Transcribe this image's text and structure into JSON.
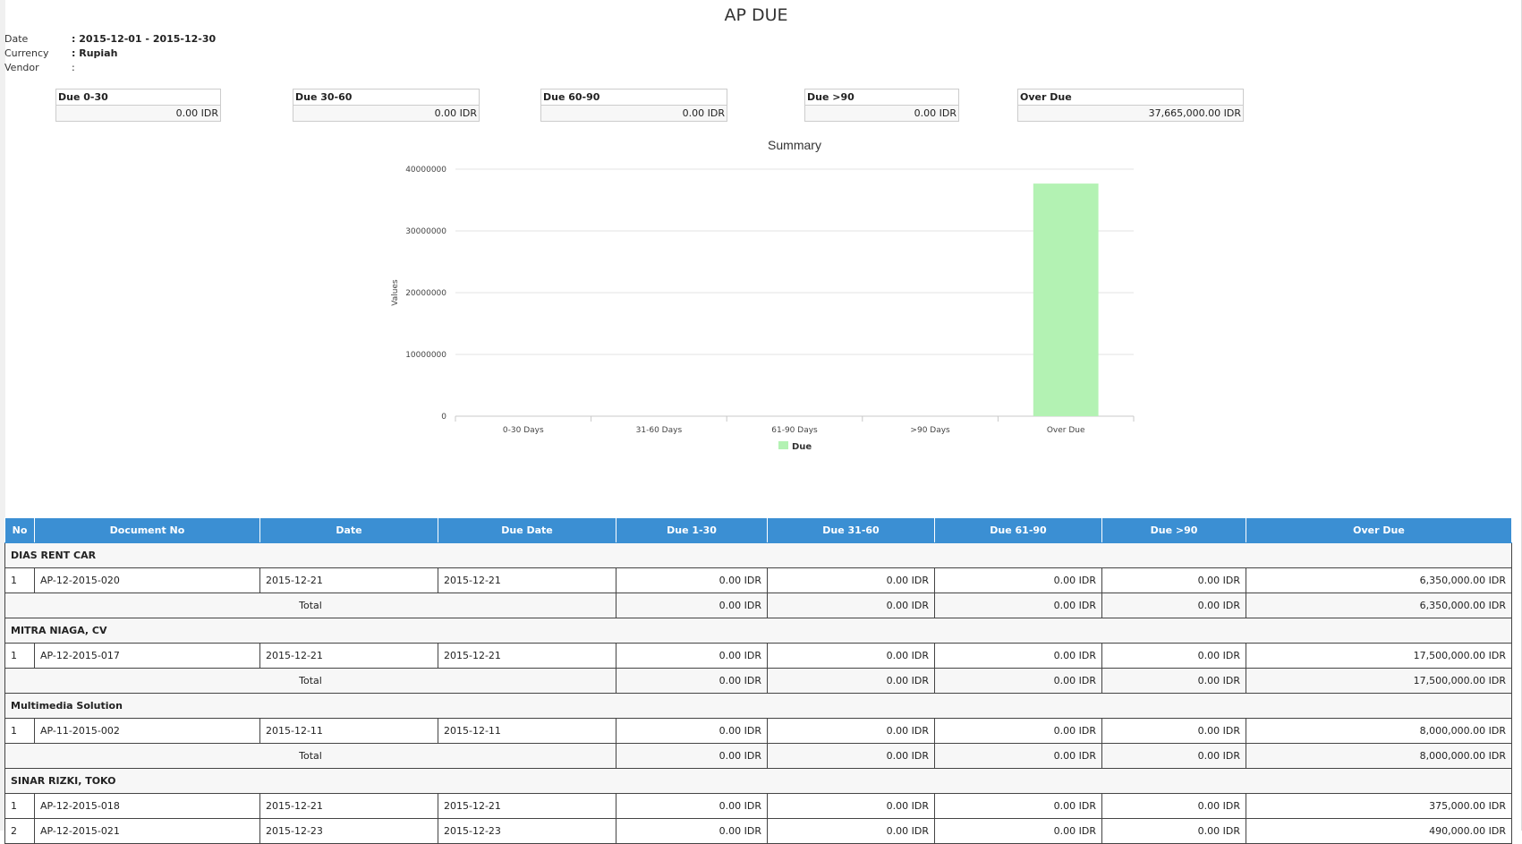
{
  "report": {
    "title": "AP DUE",
    "date_label": "Date",
    "date_value": ": 2015-12-01 - 2015-12-30",
    "currency_label": "Currency",
    "currency_value": ": Rupiah",
    "vendor_label": "Vendor",
    "vendor_value": ":"
  },
  "summary_boxes": [
    {
      "label": "Due 0-30",
      "value": "0.00 IDR"
    },
    {
      "label": "Due 30-60",
      "value": "0.00 IDR"
    },
    {
      "label": "Due 60-90",
      "value": "0.00 IDR"
    },
    {
      "label": "Due >90",
      "value": "0.00 IDR"
    },
    {
      "label": "Over Due",
      "value": "37,665,000.00 IDR"
    }
  ],
  "chart_data": {
    "type": "bar",
    "title": "Summary",
    "ylabel": "Values",
    "xlabel": "",
    "categories": [
      "0-30 Days",
      "31-60 Days",
      "61-90 Days",
      ">90 Days",
      "Over Due"
    ],
    "series": [
      {
        "name": "Due",
        "values": [
          0,
          0,
          0,
          0,
          37665000
        ]
      }
    ],
    "ylim": [
      0,
      40000000
    ],
    "yticks": [
      "0",
      "10000000",
      "20000000",
      "30000000",
      "40000000"
    ],
    "grid": true,
    "legend": "bottom-center",
    "bar_color": "#b3f2b3"
  },
  "table": {
    "headers": [
      "No",
      "Document No",
      "Date",
      "Due Date",
      "Due 1-30",
      "Due 31-60",
      "Due 61-90",
      "Due >90",
      "Over Due"
    ],
    "header_color": "#3b8fd3",
    "total_label": "Total",
    "groups": [
      {
        "vendor": "DIAS RENT CAR",
        "rows": [
          {
            "no": "1",
            "doc": "AP-12-2015-020",
            "date": "2015-12-21",
            "due_date": "2015-12-21",
            "d1": "0.00 IDR",
            "d2": "0.00 IDR",
            "d3": "0.00 IDR",
            "d4": "0.00 IDR",
            "over": "6,350,000.00 IDR"
          }
        ],
        "total": {
          "d1": "0.00 IDR",
          "d2": "0.00 IDR",
          "d3": "0.00 IDR",
          "d4": "0.00 IDR",
          "over": "6,350,000.00 IDR"
        }
      },
      {
        "vendor": "MITRA NIAGA, CV",
        "rows": [
          {
            "no": "1",
            "doc": "AP-12-2015-017",
            "date": "2015-12-21",
            "due_date": "2015-12-21",
            "d1": "0.00 IDR",
            "d2": "0.00 IDR",
            "d3": "0.00 IDR",
            "d4": "0.00 IDR",
            "over": "17,500,000.00 IDR"
          }
        ],
        "total": {
          "d1": "0.00 IDR",
          "d2": "0.00 IDR",
          "d3": "0.00 IDR",
          "d4": "0.00 IDR",
          "over": "17,500,000.00 IDR"
        }
      },
      {
        "vendor": "Multimedia Solution",
        "rows": [
          {
            "no": "1",
            "doc": "AP-11-2015-002",
            "date": "2015-12-11",
            "due_date": "2015-12-11",
            "d1": "0.00 IDR",
            "d2": "0.00 IDR",
            "d3": "0.00 IDR",
            "d4": "0.00 IDR",
            "over": "8,000,000.00 IDR"
          }
        ],
        "total": {
          "d1": "0.00 IDR",
          "d2": "0.00 IDR",
          "d3": "0.00 IDR",
          "d4": "0.00 IDR",
          "over": "8,000,000.00 IDR"
        }
      },
      {
        "vendor": "SINAR RIZKI, TOKO",
        "rows": [
          {
            "no": "1",
            "doc": "AP-12-2015-018",
            "date": "2015-12-21",
            "due_date": "2015-12-21",
            "d1": "0.00 IDR",
            "d2": "0.00 IDR",
            "d3": "0.00 IDR",
            "d4": "0.00 IDR",
            "over": "375,000.00 IDR"
          },
          {
            "no": "2",
            "doc": "AP-12-2015-021",
            "date": "2015-12-23",
            "due_date": "2015-12-23",
            "d1": "0.00 IDR",
            "d2": "0.00 IDR",
            "d3": "0.00 IDR",
            "d4": "0.00 IDR",
            "over": "490,000.00 IDR"
          }
        ]
      }
    ]
  }
}
